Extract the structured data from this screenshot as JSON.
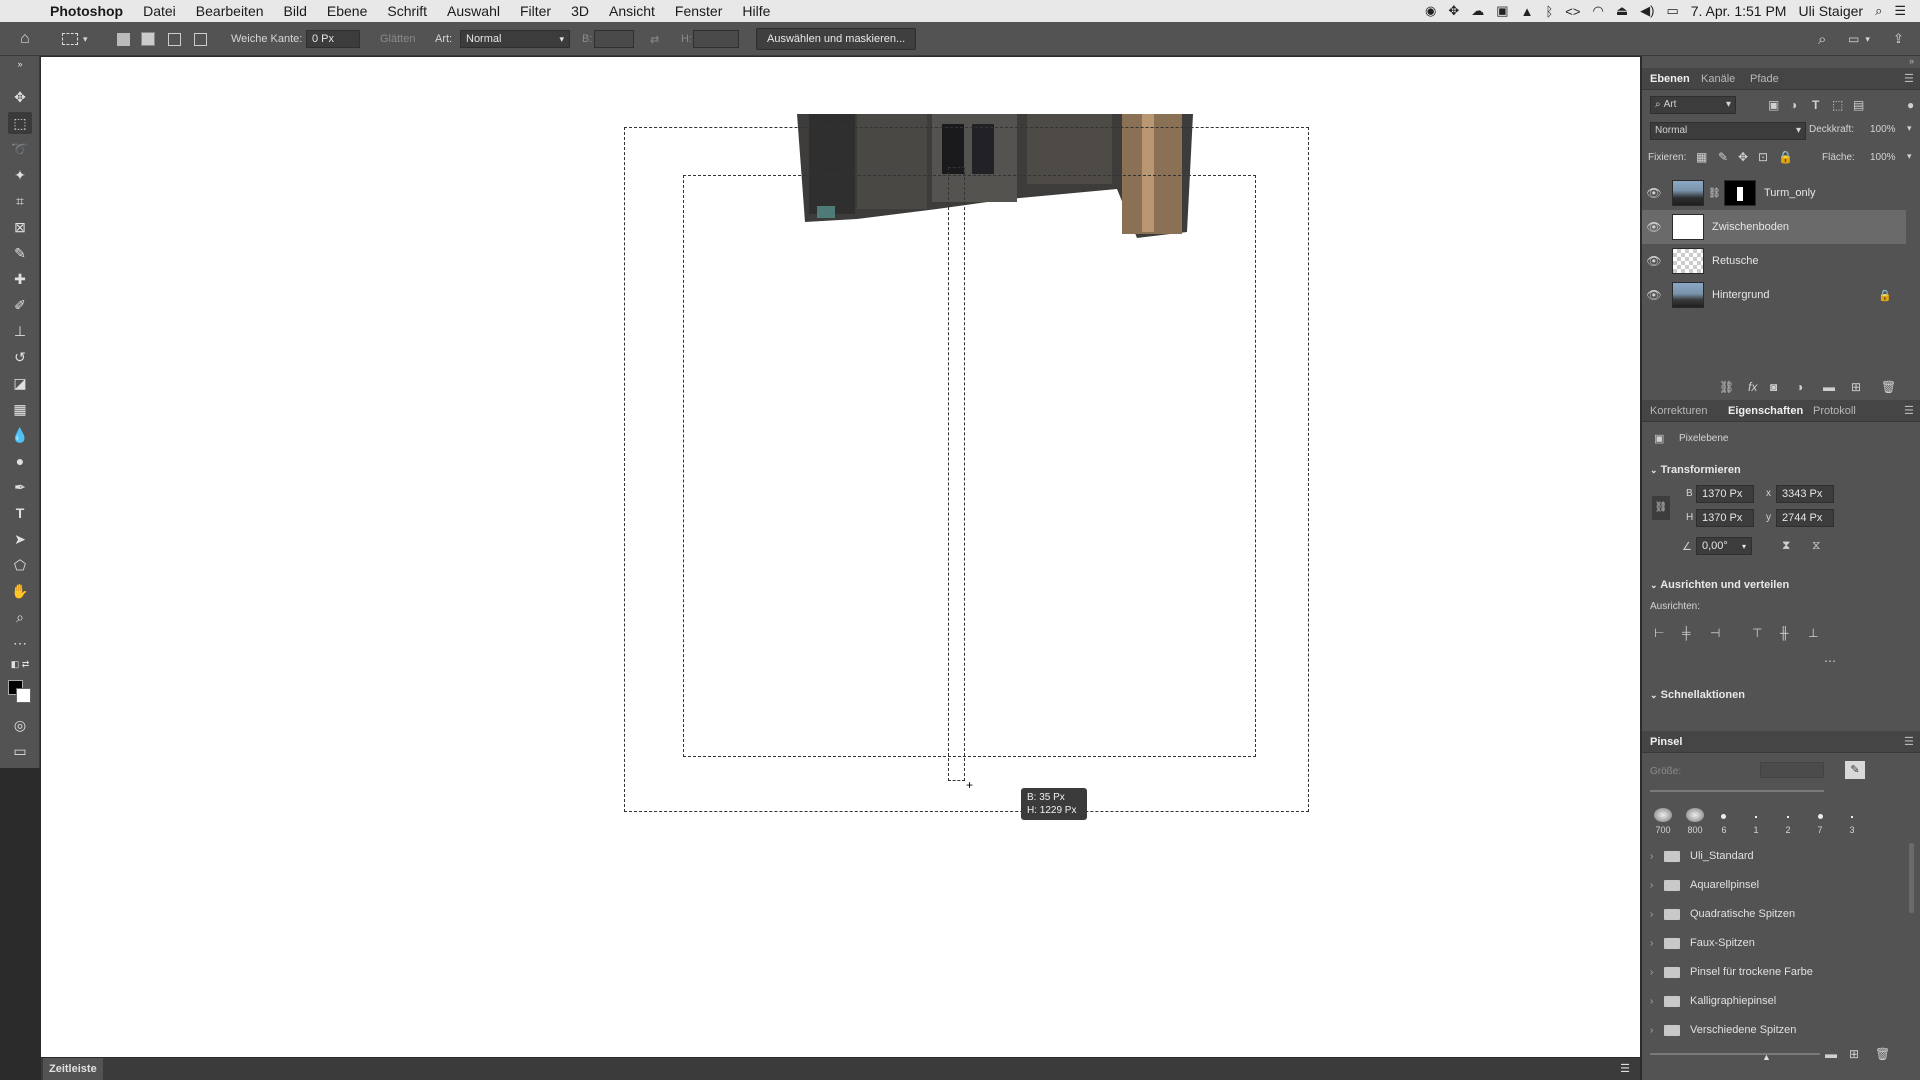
{
  "menubar": {
    "app": "Photoshop",
    "items": [
      "Datei",
      "Bearbeiten",
      "Bild",
      "Ebene",
      "Schrift",
      "Auswahl",
      "Filter",
      "3D",
      "Ansicht",
      "Fenster",
      "Hilfe"
    ],
    "clock": "7. Apr.  1:51 PM",
    "user": "Uli Staiger"
  },
  "options": {
    "feather_label": "Weiche Kante:",
    "feather_value": "0 Px",
    "antialias_label": "Glätten",
    "style_label": "Art:",
    "style_value": "Normal",
    "width_label": "B:",
    "height_label": "H:",
    "select_mask_button": "Auswählen und maskieren..."
  },
  "hud": {
    "width": "B:    35 Px",
    "height": "H: 1229 Px"
  },
  "timeline": {
    "tab": "Zeitleiste"
  },
  "layers_panel": {
    "tabs": [
      "Ebenen",
      "Kanäle",
      "Pfade"
    ],
    "filter_label": "Art",
    "blend_mode": "Normal",
    "opacity_label": "Deckkraft:",
    "opacity_value": "100%",
    "lock_label": "Fixieren:",
    "fill_label": "Fläche:",
    "fill_value": "100%",
    "layers": [
      {
        "name": "Turm_only",
        "visible": true,
        "selected": false
      },
      {
        "name": "Zwischenboden",
        "visible": true,
        "selected": true
      },
      {
        "name": "Retusche",
        "visible": true,
        "selected": false
      },
      {
        "name": "Hintergrund",
        "visible": true,
        "selected": false,
        "locked": true
      }
    ]
  },
  "properties_panel": {
    "tabs": [
      "Korrekturen",
      "Eigenschaften",
      "Protokoll"
    ],
    "layer_type": "Pixelebene",
    "transform_title": "Transformieren",
    "w_label": "B",
    "w_value": "1370 Px",
    "x_label": "x",
    "x_value": "3343 Px",
    "h_label": "H",
    "h_value": "1370 Px",
    "y_label": "y",
    "y_value": "2744 Px",
    "angle_value": "0,00°",
    "align_title": "Ausrichten und verteilen",
    "align_label": "Ausrichten:",
    "quick_actions_title": "Schnellaktionen"
  },
  "brush_panel": {
    "title": "Pinsel",
    "size_label": "Größe:",
    "presets": [
      "700",
      "800",
      "6",
      "1",
      "2",
      "7",
      "3"
    ],
    "folders": [
      "Uli_Standard",
      "Aquarellpinsel",
      "Quadratische Spitzen",
      "Faux-Spitzen",
      "Pinsel für trockene Farbe",
      "Kalligraphiepinsel",
      "Verschiedene Spitzen"
    ]
  }
}
